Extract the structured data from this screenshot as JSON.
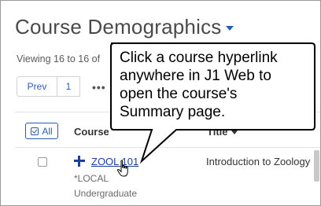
{
  "page": {
    "title": "Course Demographics",
    "viewing_text": "Viewing 16 to 16 of"
  },
  "pager": {
    "prev_label": "Prev",
    "page_label": "1",
    "ellipsis_label": "•••"
  },
  "table": {
    "select_all_label": "All",
    "columns": {
      "course": "Course",
      "title": "Title"
    },
    "rows": [
      {
        "course_code": "ZOOL 101",
        "location": "*LOCAL",
        "level": "Undergraduate",
        "title": "Introduction to Zoology"
      }
    ]
  },
  "callout": {
    "lines": [
      "Click a course hyperlink",
      "anywhere in J1 Web to",
      "open the course's",
      "Summary page."
    ]
  },
  "colors": {
    "accent": "#2a5db0",
    "link": "#1c3f9c",
    "title_text": "#4a4a4a"
  }
}
